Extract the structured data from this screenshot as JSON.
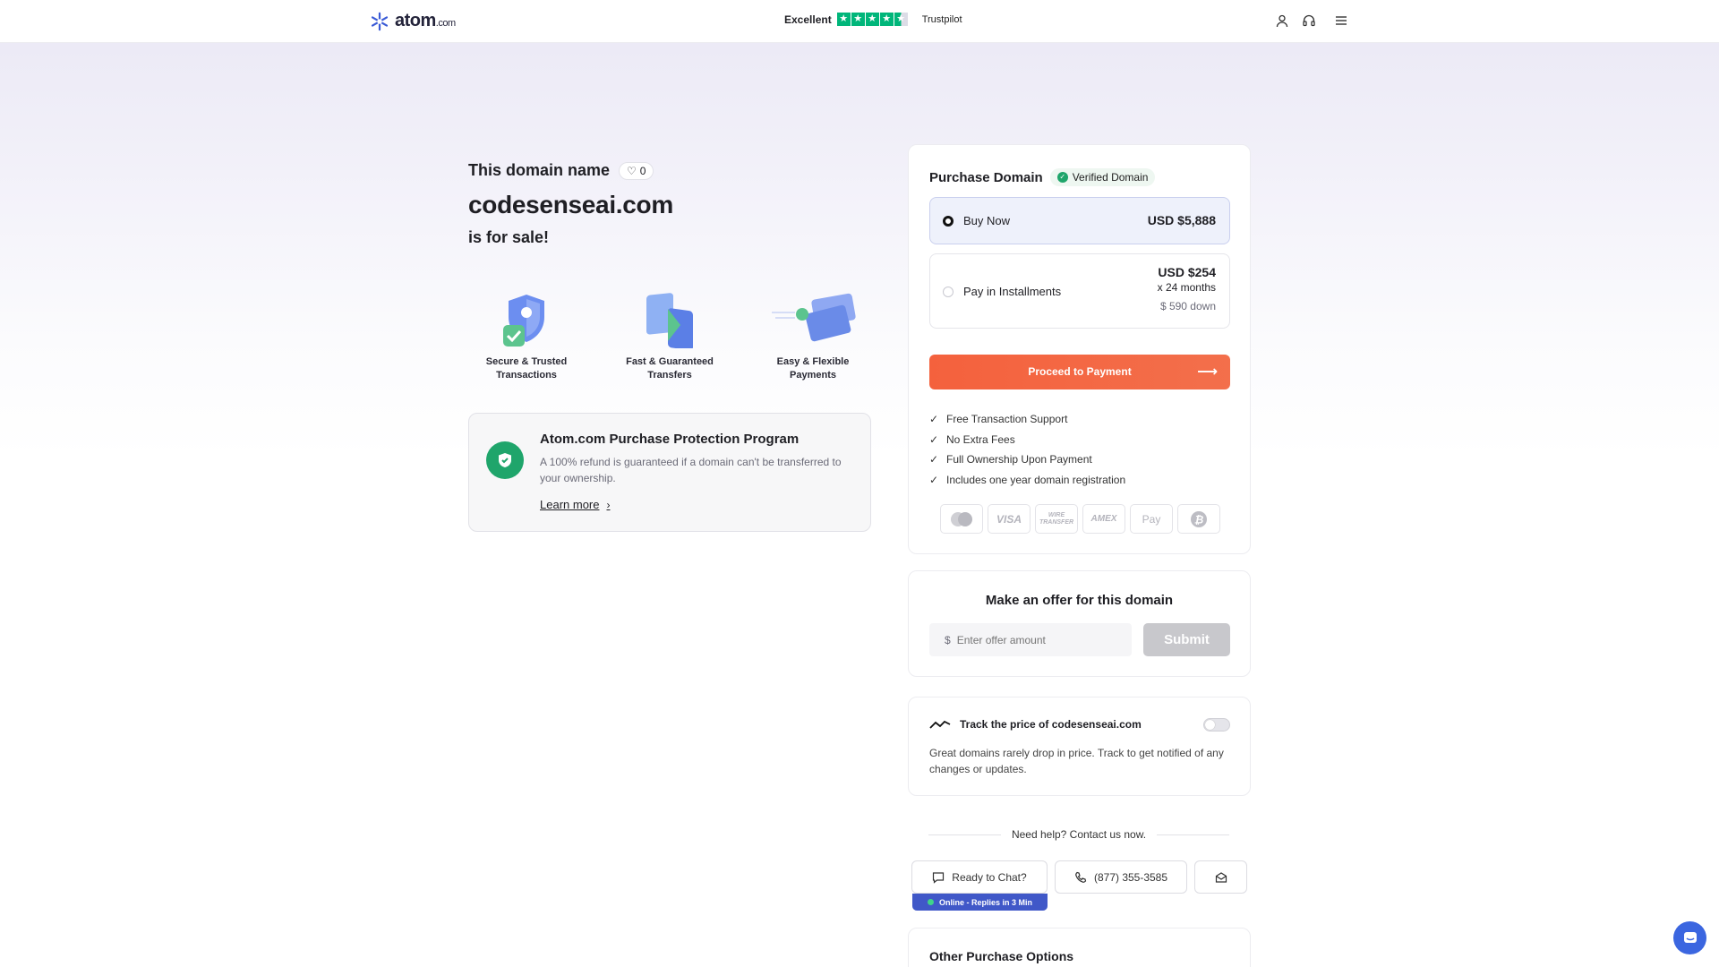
{
  "header": {
    "logo_text": "atom",
    "logo_suffix": ".com",
    "trustpilot_rating": "Excellent",
    "trustpilot_brand": "Trustpilot",
    "icons": [
      "user-icon",
      "headset-icon",
      "menu-icon"
    ]
  },
  "hero": {
    "pre_title": "This domain name",
    "likes": "0",
    "domain": "codesenseai.com",
    "post_title": "is for sale!"
  },
  "features": [
    {
      "label": "Secure & Trusted Transactions"
    },
    {
      "label": "Fast & Guaranteed Transfers"
    },
    {
      "label": "Easy & Flexible Payments"
    }
  ],
  "protection": {
    "title": "Atom.com Purchase Protection Program",
    "description": "A 100% refund is guaranteed if a domain can't be transferred to your ownership.",
    "link": "Learn more"
  },
  "purchase": {
    "title": "Purchase Domain",
    "verified": "Verified Domain",
    "buy_now": {
      "label": "Buy Now",
      "price": "USD $5,888"
    },
    "installments": {
      "label": "Pay in Installments",
      "price": "USD $254",
      "term": "x 24 months",
      "down": "$ 590 down"
    },
    "cta": "Proceed to Payment",
    "benefits": [
      "Free Transaction Support",
      "No Extra Fees",
      "Full Ownership Upon Payment",
      "Includes one year domain registration"
    ],
    "payment_methods": [
      "mastercard",
      "VISA",
      "WIRE TRANSFER",
      "AMEX",
      "Pay",
      "bitcoin"
    ]
  },
  "offer": {
    "title": "Make an offer for this domain",
    "currency": "$",
    "placeholder": "Enter offer amount",
    "submit": "Submit"
  },
  "track": {
    "title": "Track the price of codesenseai.com",
    "description": "Great domains rarely drop in price. Track to get notified of any changes or updates."
  },
  "help": {
    "title": "Need help? Contact us now.",
    "chat": "Ready to Chat?",
    "phone": "(877) 355-3585",
    "online": "Online - Replies in 3 Min"
  },
  "other": {
    "title": "Other Purchase Options"
  },
  "colors": {
    "accent": "#f4613d",
    "verified": "#1fa56b",
    "online_bar": "#4058c8",
    "trustpilot": "#00b67a"
  }
}
